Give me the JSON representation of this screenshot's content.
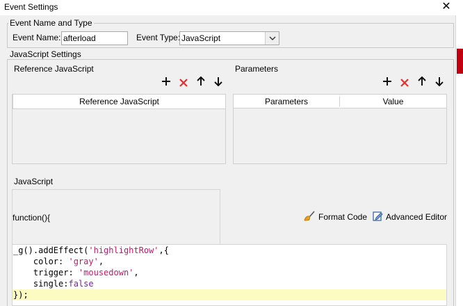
{
  "window": {
    "title": "Event Settings",
    "close_icon": "close-icon"
  },
  "event_name_type": {
    "legend": "Event Name and Type",
    "name_label": "Event Name:",
    "name_value": "afterload",
    "type_label": "Event Type:",
    "type_value": "JavaScript"
  },
  "js_settings": {
    "legend": "JavaScript Settings",
    "reference_title": "Reference JavaScript",
    "reference_table": {
      "columns": [
        "Reference JavaScript"
      ],
      "rows": []
    },
    "parameters_title": "Parameters",
    "parameters_table": {
      "columns": [
        "Parameters",
        "Value"
      ],
      "rows": []
    },
    "toolbar_icons": [
      "add-icon",
      "delete-icon",
      "move-up-icon",
      "move-down-icon"
    ]
  },
  "javascript": {
    "label": "JavaScript",
    "function_header": "function(){",
    "format_code_label": "Format Code",
    "advanced_editor_label": "Advanced Editor",
    "code_lines": [
      "_g().addEffect('highlightRow',{",
      "    color: 'gray',",
      "    trigger: 'mousedown',",
      "    single:false",
      "});"
    ]
  },
  "colors": {
    "delete_icon": "#e53030",
    "code_string": "#c6166c",
    "code_keyword": "#7a1faa",
    "current_line_highlight": "#fcfbc2"
  }
}
